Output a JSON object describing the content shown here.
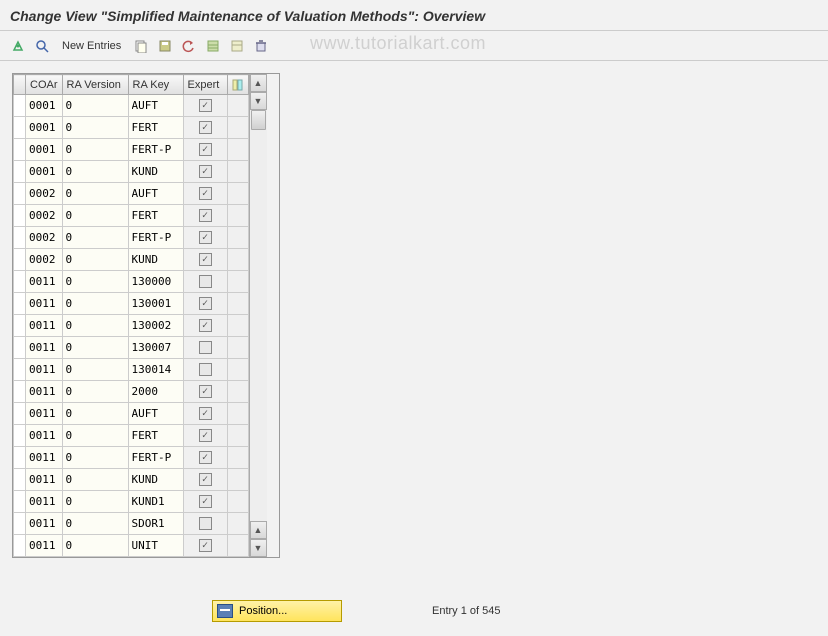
{
  "title": "Change View \"Simplified Maintenance of Valuation Methods\": Overview",
  "toolbar": {
    "new_entries": "New Entries"
  },
  "watermark": "www.tutorialkart.com",
  "columns": {
    "coar": "COAr",
    "ra_version": "RA Version",
    "ra_key": "RA Key",
    "expert": "Expert"
  },
  "rows": [
    {
      "coar": "0001",
      "raver": "0",
      "rakey": "AUFT",
      "expert": true
    },
    {
      "coar": "0001",
      "raver": "0",
      "rakey": "FERT",
      "expert": true
    },
    {
      "coar": "0001",
      "raver": "0",
      "rakey": "FERT-P",
      "expert": true
    },
    {
      "coar": "0001",
      "raver": "0",
      "rakey": "KUND",
      "expert": true
    },
    {
      "coar": "0002",
      "raver": "0",
      "rakey": "AUFT",
      "expert": true
    },
    {
      "coar": "0002",
      "raver": "0",
      "rakey": "FERT",
      "expert": true
    },
    {
      "coar": "0002",
      "raver": "0",
      "rakey": "FERT-P",
      "expert": true
    },
    {
      "coar": "0002",
      "raver": "0",
      "rakey": "KUND",
      "expert": true
    },
    {
      "coar": "0011",
      "raver": "0",
      "rakey": "130000",
      "expert": false
    },
    {
      "coar": "0011",
      "raver": "0",
      "rakey": "130001",
      "expert": true
    },
    {
      "coar": "0011",
      "raver": "0",
      "rakey": "130002",
      "expert": true
    },
    {
      "coar": "0011",
      "raver": "0",
      "rakey": "130007",
      "expert": false
    },
    {
      "coar": "0011",
      "raver": "0",
      "rakey": "130014",
      "expert": false
    },
    {
      "coar": "0011",
      "raver": "0",
      "rakey": "2000",
      "expert": true
    },
    {
      "coar": "0011",
      "raver": "0",
      "rakey": "AUFT",
      "expert": true
    },
    {
      "coar": "0011",
      "raver": "0",
      "rakey": "FERT",
      "expert": true
    },
    {
      "coar": "0011",
      "raver": "0",
      "rakey": "FERT-P",
      "expert": true
    },
    {
      "coar": "0011",
      "raver": "0",
      "rakey": "KUND",
      "expert": true
    },
    {
      "coar": "0011",
      "raver": "0",
      "rakey": "KUND1",
      "expert": true
    },
    {
      "coar": "0011",
      "raver": "0",
      "rakey": "SDOR1",
      "expert": false
    },
    {
      "coar": "0011",
      "raver": "0",
      "rakey": "UNIT",
      "expert": true
    }
  ],
  "footer": {
    "position_label": "Position...",
    "entry_text": "Entry 1 of 545"
  }
}
